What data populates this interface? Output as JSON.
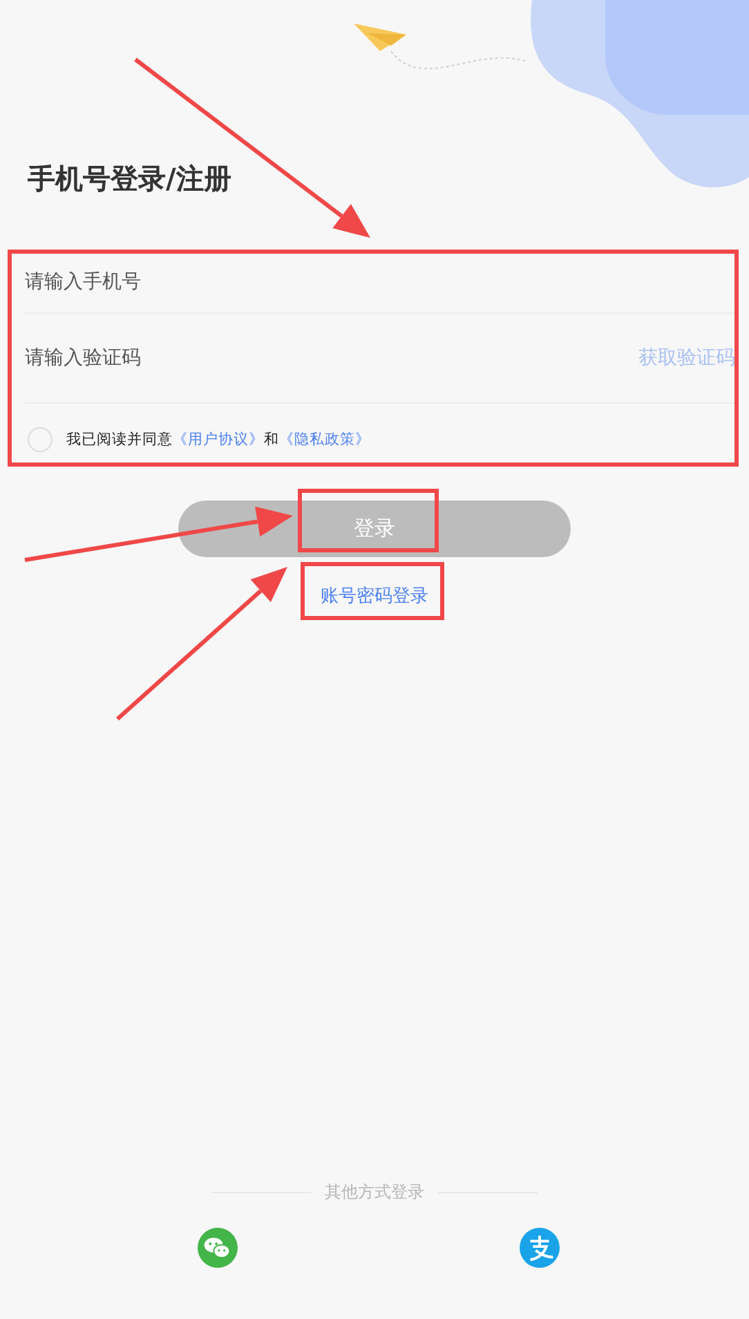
{
  "title": "手机号登录/注册",
  "phone_field": {
    "placeholder": "请输入手机号"
  },
  "code_field": {
    "placeholder": "请输入验证码",
    "action": "获取验证码"
  },
  "agreement": {
    "checked": false,
    "parts": [
      {
        "kind": "text",
        "text": "我已阅读并同意"
      },
      {
        "kind": "link",
        "text": "《用户协议》"
      },
      {
        "kind": "text",
        "text": "和"
      },
      {
        "kind": "link",
        "text": "《隐私政策》"
      }
    ]
  },
  "login_button": {
    "label": "登录",
    "disabled": true
  },
  "password_login_link": "账号密码登录",
  "other_login": {
    "label": "其他方式登录",
    "providers": [
      {
        "kind": "wechat"
      },
      {
        "kind": "alipay"
      }
    ]
  },
  "annotations": [
    {
      "kind": "arrow"
    },
    {
      "kind": "box"
    },
    {
      "kind": "arrow"
    },
    {
      "kind": "box"
    },
    {
      "kind": "arrow"
    },
    {
      "kind": "box"
    }
  ]
}
